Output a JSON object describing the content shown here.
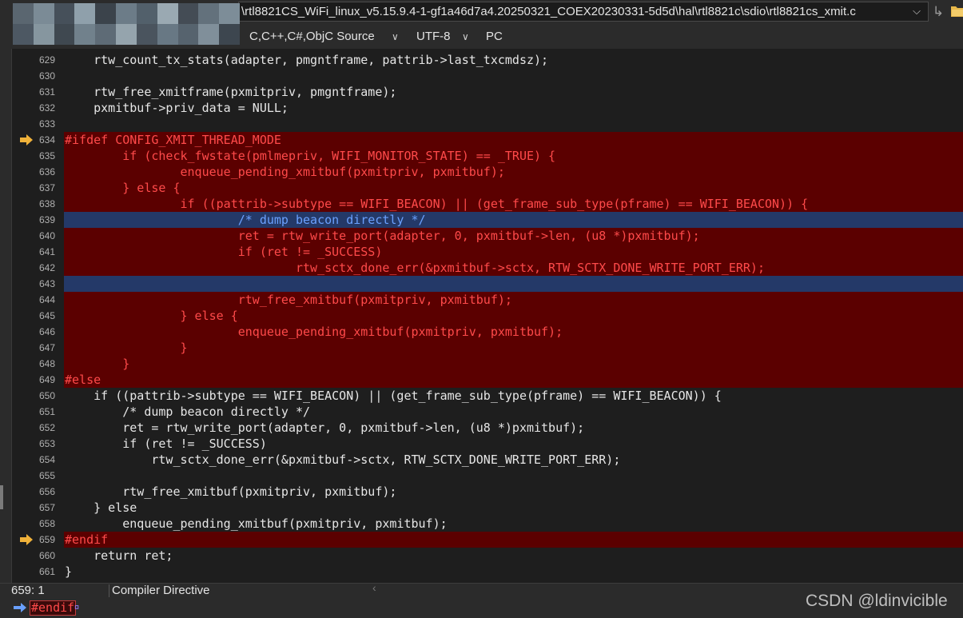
{
  "window": {
    "file_path": "\\rtl8821CS_WiFi_linux_v5.15.9.4-1-gf1a46d7a4.20250321_COEX20230331-5d5d\\hal\\rtl8821c\\sdio\\rtl8821cs_xmit.c",
    "icons": [
      "chevron-down-icon",
      "redo-arrow-icon",
      "folder-icon"
    ]
  },
  "toolbar": {
    "language": "C,C++,C#,ObjC Source",
    "encoding": "UTF-8",
    "line_ending": "PC"
  },
  "editor": {
    "lines": [
      {
        "n": "629",
        "code": "    rtw_count_tx_stats(adapter, pmgntframe, pattrib->last_txcmdsz);",
        "style": "plain"
      },
      {
        "n": "630",
        "code": "",
        "style": "plain"
      },
      {
        "n": "631",
        "code": "    rtw_free_xmitframe(pxmitpriv, pmgntframe);",
        "style": "plain"
      },
      {
        "n": "632",
        "code": "    pxmitbuf->priv_data = NULL;",
        "style": "plain"
      },
      {
        "n": "633",
        "code": "",
        "style": "plain"
      },
      {
        "n": "634",
        "code": "#ifdef CONFIG_XMIT_THREAD_MODE",
        "style": "red",
        "marker": true
      },
      {
        "n": "635",
        "code": "        if (check_fwstate(pmlmepriv, WIFI_MONITOR_STATE) == _TRUE) {",
        "style": "red"
      },
      {
        "n": "636",
        "code": "                enqueue_pending_xmitbuf(pxmitpriv, pxmitbuf);",
        "style": "red"
      },
      {
        "n": "637",
        "code": "        } else {",
        "style": "red"
      },
      {
        "n": "638",
        "code": "                if ((pattrib->subtype == WIFI_BEACON) || (get_frame_sub_type(pframe) == WIFI_BEACON)) {",
        "style": "red"
      },
      {
        "n": "639",
        "code": "                        /* dump beacon directly */",
        "style": "blue"
      },
      {
        "n": "640",
        "code": "                        ret = rtw_write_port(adapter, 0, pxmitbuf->len, (u8 *)pxmitbuf);",
        "style": "red"
      },
      {
        "n": "641",
        "code": "                        if (ret != _SUCCESS)",
        "style": "red"
      },
      {
        "n": "642",
        "code": "                                rtw_sctx_done_err(&pxmitbuf->sctx, RTW_SCTX_DONE_WRITE_PORT_ERR);",
        "style": "red"
      },
      {
        "n": "643",
        "code": "",
        "style": "blue"
      },
      {
        "n": "644",
        "code": "                        rtw_free_xmitbuf(pxmitpriv, pxmitbuf);",
        "style": "red"
      },
      {
        "n": "645",
        "code": "                } else {",
        "style": "red"
      },
      {
        "n": "646",
        "code": "                        enqueue_pending_xmitbuf(pxmitpriv, pxmitbuf);",
        "style": "red"
      },
      {
        "n": "647",
        "code": "                }",
        "style": "red"
      },
      {
        "n": "648",
        "code": "        }",
        "style": "red"
      },
      {
        "n": "649",
        "code": "#else",
        "style": "red"
      },
      {
        "n": "650",
        "code": "    if ((pattrib->subtype == WIFI_BEACON) || (get_frame_sub_type(pframe) == WIFI_BEACON)) {",
        "style": "plain"
      },
      {
        "n": "651",
        "code": "        /* dump beacon directly */",
        "style": "plain"
      },
      {
        "n": "652",
        "code": "        ret = rtw_write_port(adapter, 0, pxmitbuf->len, (u8 *)pxmitbuf);",
        "style": "plain"
      },
      {
        "n": "653",
        "code": "        if (ret != _SUCCESS)",
        "style": "plain"
      },
      {
        "n": "654",
        "code": "            rtw_sctx_done_err(&pxmitbuf->sctx, RTW_SCTX_DONE_WRITE_PORT_ERR);",
        "style": "plain"
      },
      {
        "n": "655",
        "code": "",
        "style": "plain"
      },
      {
        "n": "656",
        "code": "        rtw_free_xmitbuf(pxmitpriv, pxmitbuf);",
        "style": "plain"
      },
      {
        "n": "657",
        "code": "    } else",
        "style": "plain"
      },
      {
        "n": "658",
        "code": "        enqueue_pending_xmitbuf(pxmitpriv, pxmitbuf);",
        "style": "plain"
      },
      {
        "n": "659",
        "code": "#endif",
        "style": "red",
        "marker": true
      },
      {
        "n": "660",
        "code": "    return ret;",
        "style": "plain"
      },
      {
        "n": "661",
        "code": "}",
        "style": "plain"
      }
    ]
  },
  "status": {
    "position": "659: 1",
    "scope": "Compiler Directive"
  },
  "bottom": {
    "token": "#endif",
    "cursor_glyph": "¤"
  },
  "watermark": "CSDN @ldinvicible",
  "colors": {
    "directive_bg": "#5b0000",
    "selection_bg": "#243968",
    "directive_text": "#ff4a4a",
    "marker_arrow": "#f0b23a"
  }
}
